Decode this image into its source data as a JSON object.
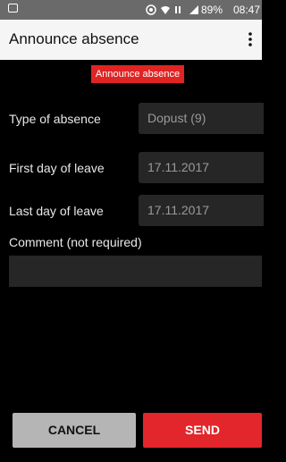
{
  "status_bar": {
    "battery": "89%",
    "time": "08:47",
    "icons": [
      "image-icon",
      "sync-icon",
      "wifi-icon",
      "lte-icon",
      "signal-icon"
    ]
  },
  "app_bar": {
    "title": "Announce absence",
    "menu_icon": "more-vert-icon"
  },
  "banner": {
    "text": "Announce absence",
    "color": "#e02424"
  },
  "form": {
    "type_label": "Type of absence",
    "type_value": "Dopust (9)",
    "first_day_label": "First day of leave",
    "first_day_value": "17.11.2017",
    "last_day_label": "Last day of leave",
    "last_day_value": "17.11.2017",
    "comment_label": "Comment (not required)",
    "comment_value": ""
  },
  "actions": {
    "cancel_label": "CANCEL",
    "send_label": "SEND",
    "send_color": "#e3262b"
  }
}
